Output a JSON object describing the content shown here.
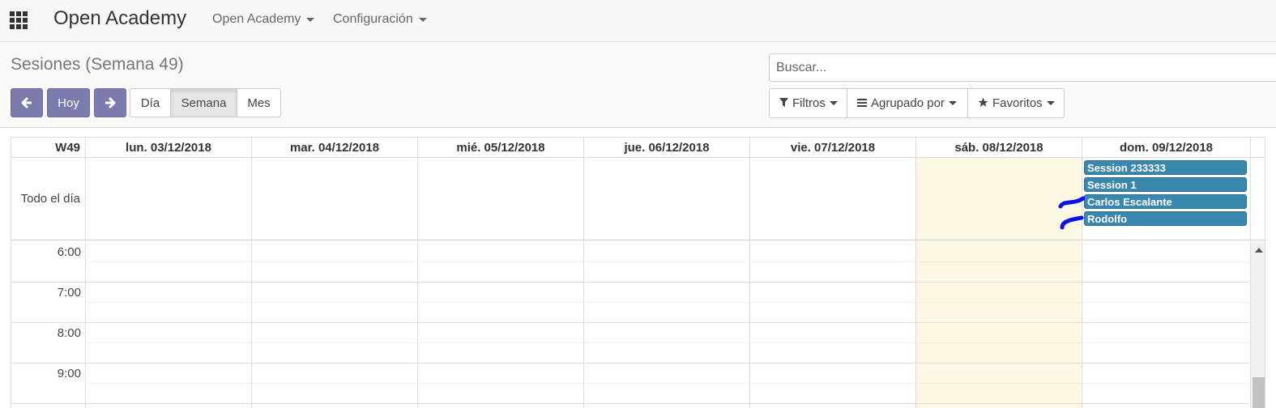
{
  "navbar": {
    "apps_icon": "apps-grid-icon",
    "brand": "Open Academy",
    "menus": [
      {
        "label": "Open Academy"
      },
      {
        "label": "Configuración"
      }
    ]
  },
  "control_panel": {
    "title": "Sesiones (Semana 49)",
    "prev_icon": "arrow-left-icon",
    "today_label": "Hoy",
    "next_icon": "arrow-right-icon",
    "views": [
      {
        "label": "Día"
      },
      {
        "label": "Semana",
        "active": true
      },
      {
        "label": "Mes"
      }
    ],
    "search_placeholder": "Buscar...",
    "filters_label": "Filtros",
    "groupby_label": "Agrupado por",
    "favorites_label": "Favoritos"
  },
  "calendar": {
    "week_label": "W49",
    "days": [
      {
        "label": "lun. 03/12/2018"
      },
      {
        "label": "mar. 04/12/2018"
      },
      {
        "label": "mié. 05/12/2018"
      },
      {
        "label": "jue. 06/12/2018"
      },
      {
        "label": "vie. 07/12/2018"
      },
      {
        "label": "sáb. 08/12/2018",
        "highlight": true
      },
      {
        "label": "dom. 09/12/2018"
      }
    ],
    "allday_label": "Todo el día",
    "events": [
      {
        "title": "Session 233333",
        "day": "dom. 09/12/2018"
      },
      {
        "title": "Session 1",
        "day": "dom. 09/12/2018"
      },
      {
        "title": "Carlos Escalante",
        "day": "dom. 09/12/2018"
      },
      {
        "title": "Rodolfo",
        "day": "dom. 09/12/2018"
      }
    ],
    "hours": [
      "6:00",
      "7:00",
      "8:00",
      "9:00"
    ],
    "colors": {
      "event": "#3a87ad",
      "highlight": "#fcf8e3",
      "primary_button": "#7c7bad"
    }
  }
}
